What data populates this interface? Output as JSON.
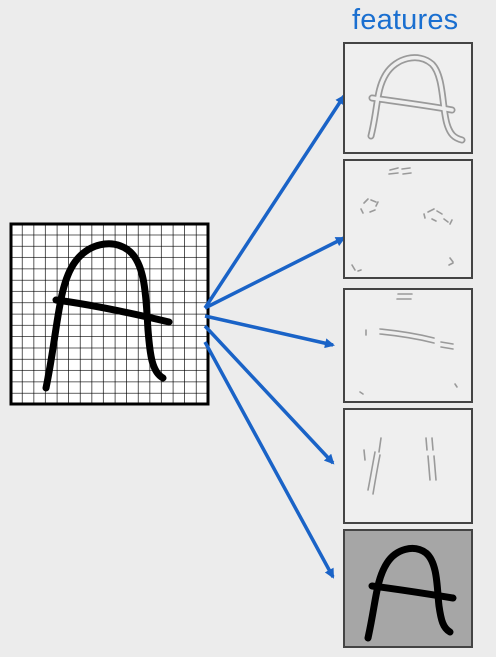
{
  "title": "features",
  "colors": {
    "title": "#1a6fd0",
    "arrow": "#1a63c7",
    "background": "#ececec",
    "feature_stroke": "#9a9a9a",
    "last_panel_fill": "#a6a6a6"
  },
  "input_image": {
    "glyph": "A",
    "grid": true
  },
  "feature_panels": [
    {
      "kind": "edge-outline"
    },
    {
      "kind": "corner-dots"
    },
    {
      "kind": "horizontal-strokes"
    },
    {
      "kind": "vertical-strokes"
    },
    {
      "kind": "full-glyph"
    }
  ]
}
